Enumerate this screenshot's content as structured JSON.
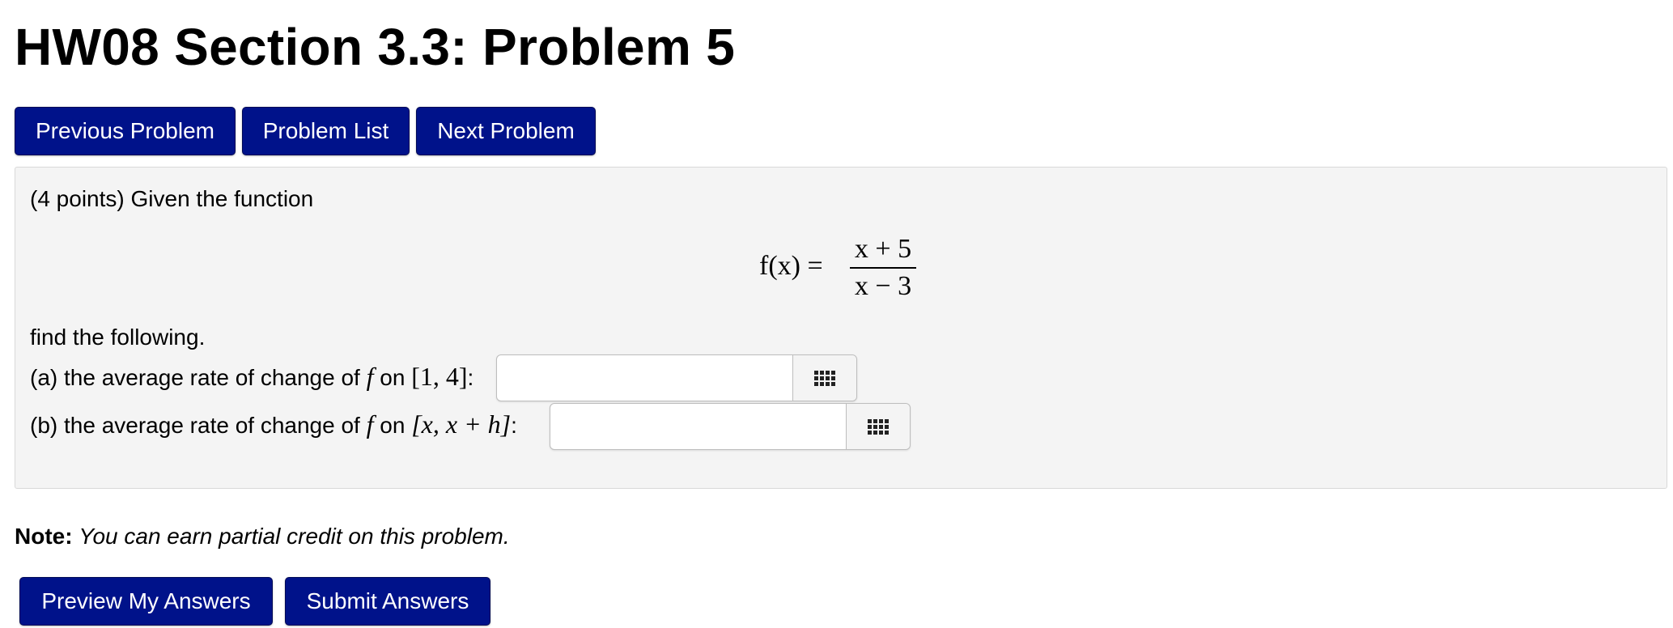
{
  "header": {
    "title": "HW08 Section 3.3: Problem 5"
  },
  "nav": {
    "previous_label": "Previous Problem",
    "list_label": "Problem List",
    "next_label": "Next Problem"
  },
  "problem": {
    "intro": "(4 points) Given the function",
    "function_lhs": "f(x) =",
    "numerator": "x + 5",
    "denominator": "x − 3",
    "instruction": "find the following.",
    "part_a": {
      "prefix": "(a) the average rate of change of",
      "func": "f",
      "on": "on",
      "interval": "[1, 4]",
      "suffix": ":",
      "value": ""
    },
    "part_b": {
      "prefix": "(b) the average rate of change of",
      "func": "f",
      "on": "on",
      "interval": "[x, x + h]",
      "suffix": ":",
      "value": ""
    }
  },
  "note": {
    "label": "Note:",
    "text": "You can earn partial credit on this problem."
  },
  "actions": {
    "preview_label": "Preview My Answers",
    "submit_label": "Submit Answers"
  },
  "colors": {
    "button_bg": "#00128a",
    "panel_bg": "#f4f4f4"
  },
  "icons": {
    "equation_editor": "grid-icon"
  }
}
